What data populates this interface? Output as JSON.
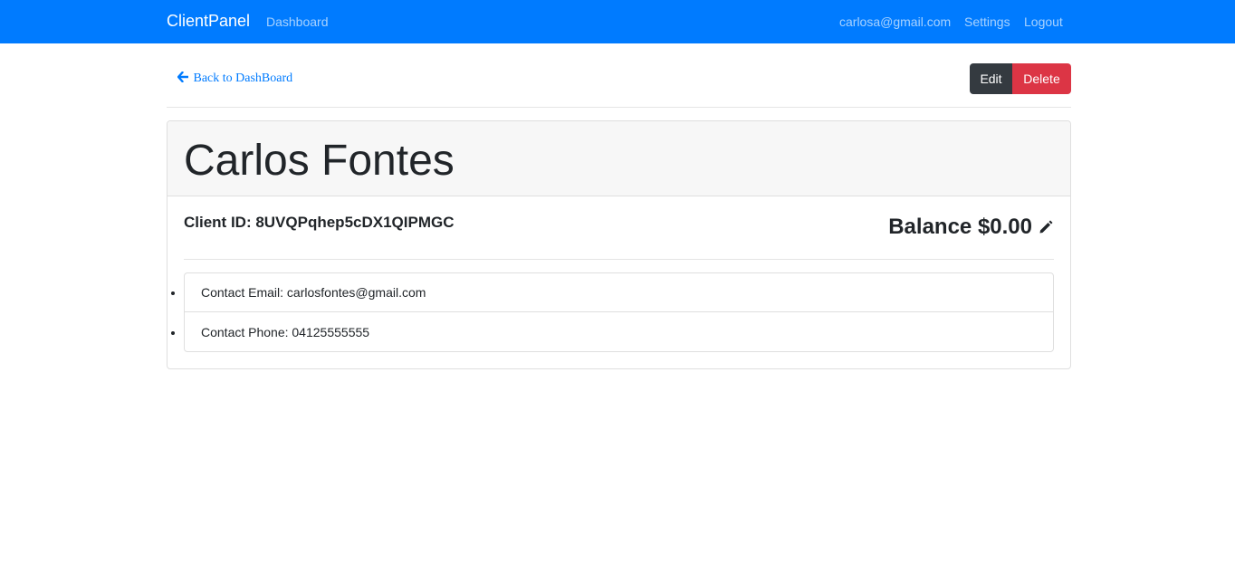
{
  "navbar": {
    "brand": "ClientPanel",
    "dashboard_link": "Dashboard",
    "user_email": "carlosa@gmail.com",
    "settings_link": "Settings",
    "logout_link": "Logout",
    "color": "#007bff"
  },
  "toolbar": {
    "back_label": "Back to DashBoard",
    "back_icon": "arrow-left-icon",
    "edit_label": "Edit",
    "delete_label": "Delete"
  },
  "client": {
    "name": "Carlos Fontes",
    "id_text": "Client ID: 8UVQPqhep5cDX1QIPMGC",
    "balance_text": "Balance $0.00",
    "balance_icon": "pencil-icon",
    "contact_email_text": "Contact Email: carlosfontes@gmail.com",
    "contact_phone_text": "Contact Phone: 04125555555"
  },
  "colors": {
    "primary": "#007bff",
    "dark": "#343a40",
    "danger": "#dc3545"
  }
}
